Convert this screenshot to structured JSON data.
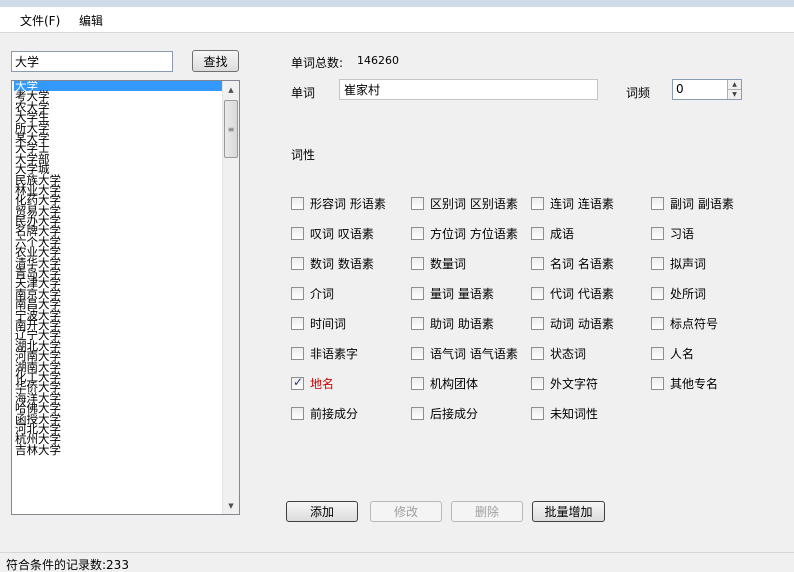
{
  "menu": [
    {
      "label": "文件(F)"
    },
    {
      "label": "编辑"
    }
  ],
  "search": {
    "value": "大学",
    "button_label": "查找"
  },
  "results": {
    "items": [
      "大学",
      "考大学",
      "农大学",
      "大学生",
      "所大学",
      "某大学",
      "大学士",
      "大学部",
      "大学城",
      "民族大学",
      "林业大学",
      "化药大学",
      "贸易大学",
      "民办大学",
      "名牌大学",
      "六个大学",
      "农业大学",
      "清华大学",
      "青岛大学",
      "天津大学",
      "南京大学",
      "南昌大学",
      "宁波大学",
      "南开大学",
      "辽宁大学",
      "湖北大学",
      "河南大学",
      "湖南大学",
      "化工大学",
      "华侨大学",
      "海洋大学",
      "哈佛大学",
      "函授大学",
      "河北大学",
      "杭州大学",
      "吉林大学"
    ],
    "selected_index": 0
  },
  "stats": {
    "total_label": "单词总数:",
    "total_value": "146260"
  },
  "word": {
    "label": "单词",
    "value": "崔家村"
  },
  "frequency": {
    "label": "词频",
    "value": "0"
  },
  "pos": {
    "label": "词性",
    "options": [
      {
        "label": "形容词  形语素",
        "checked": false
      },
      {
        "label": "区别词  区别语素",
        "checked": false
      },
      {
        "label": "连词  连语素",
        "checked": false
      },
      {
        "label": "副词  副语素",
        "checked": false
      },
      {
        "label": "叹词  叹语素",
        "checked": false
      },
      {
        "label": "方位词  方位语素",
        "checked": false
      },
      {
        "label": "成语",
        "checked": false
      },
      {
        "label": "习语",
        "checked": false
      },
      {
        "label": "数词  数语素",
        "checked": false
      },
      {
        "label": "数量词",
        "checked": false
      },
      {
        "label": "名词  名语素",
        "checked": false
      },
      {
        "label": "拟声词",
        "checked": false
      },
      {
        "label": "介词",
        "checked": false
      },
      {
        "label": "量词  量语素",
        "checked": false
      },
      {
        "label": "代词  代语素",
        "checked": false
      },
      {
        "label": "处所词",
        "checked": false
      },
      {
        "label": "时间词",
        "checked": false
      },
      {
        "label": "助词  助语素",
        "checked": false
      },
      {
        "label": "动词  动语素",
        "checked": false
      },
      {
        "label": "标点符号",
        "checked": false
      },
      {
        "label": "非语素字",
        "checked": false
      },
      {
        "label": "语气词  语气语素",
        "checked": false
      },
      {
        "label": "状态词",
        "checked": false
      },
      {
        "label": "人名",
        "checked": false
      },
      {
        "label": "地名",
        "checked": true
      },
      {
        "label": "机构团体",
        "checked": false
      },
      {
        "label": "外文字符",
        "checked": false
      },
      {
        "label": "其他专名",
        "checked": false
      },
      {
        "label": "前接成分",
        "checked": false
      },
      {
        "label": "后接成分",
        "checked": false
      },
      {
        "label": "未知词性",
        "checked": false
      }
    ]
  },
  "actions": {
    "add": "添加",
    "modify": "修改",
    "delete": "删除",
    "batch_add": "批量增加"
  },
  "status": {
    "text": "符合条件的记录数:233"
  },
  "colors": {
    "selection": "#3399ff",
    "checked_label": "#d40000"
  }
}
